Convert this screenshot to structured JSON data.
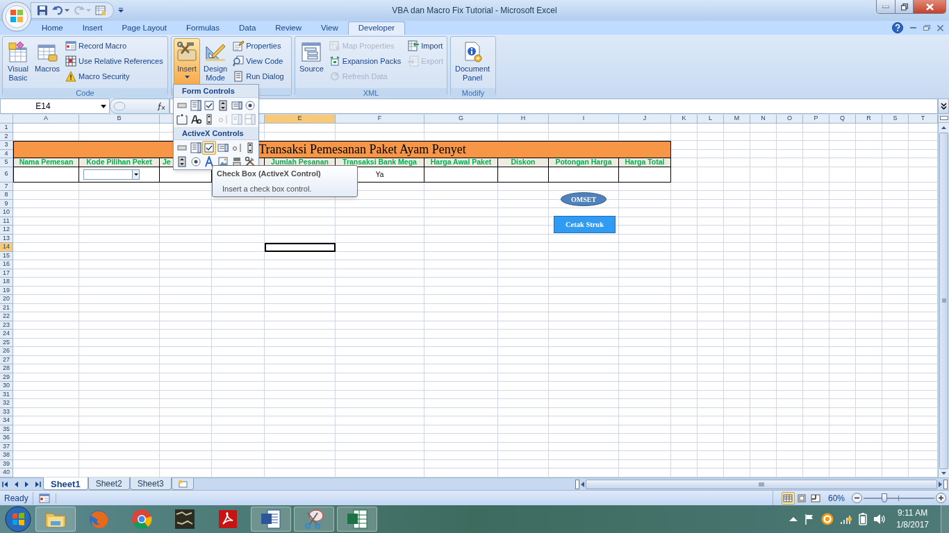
{
  "window": {
    "title": "VBA dan Macro Fix Tutorial - Microsoft Excel"
  },
  "tabs": [
    {
      "label": "Home",
      "selected": false
    },
    {
      "label": "Insert",
      "selected": false
    },
    {
      "label": "Page Layout",
      "selected": false
    },
    {
      "label": "Formulas",
      "selected": false
    },
    {
      "label": "Data",
      "selected": false
    },
    {
      "label": "Review",
      "selected": false
    },
    {
      "label": "View",
      "selected": false
    },
    {
      "label": "Developer",
      "selected": true
    }
  ],
  "ribbon": [
    {
      "label": "Code",
      "items": [
        {
          "label": "Visual Basic",
          "kind": "large",
          "disabled": false,
          "pressed": false
        },
        {
          "label": "Macros",
          "kind": "large",
          "disabled": false,
          "pressed": false
        },
        {
          "label": "Record Macro",
          "kind": "small",
          "disabled": false,
          "pressed": false
        },
        {
          "label": "Use Relative References",
          "kind": "small",
          "disabled": false,
          "pressed": false
        },
        {
          "label": "Macro Security",
          "kind": "small",
          "disabled": false,
          "pressed": false
        }
      ]
    },
    {
      "items": [
        {
          "label": "Insert",
          "kind": "menu",
          "disabled": false,
          "pressed": true
        },
        {
          "label": "Design Mode",
          "kind": "large",
          "disabled": false,
          "pressed": false
        },
        {
          "label": "Properties",
          "kind": "small",
          "disabled": false,
          "pressed": false
        },
        {
          "label": "View Code",
          "kind": "small",
          "disabled": false,
          "pressed": false
        },
        {
          "label": "Run Dialog",
          "kind": "small",
          "disabled": false,
          "pressed": false
        }
      ]
    },
    {
      "label": "XML",
      "items": [
        {
          "label": "Source",
          "kind": "large",
          "disabled": false,
          "pressed": false
        },
        {
          "label": "Map Properties",
          "kind": "small",
          "disabled": true,
          "pressed": false
        },
        {
          "label": "Expansion Packs",
          "kind": "small",
          "disabled": false,
          "pressed": false
        },
        {
          "label": "Refresh Data",
          "kind": "small",
          "disabled": true,
          "pressed": false
        },
        {
          "label": "Import",
          "kind": "small",
          "disabled": false,
          "pressed": false
        },
        {
          "label": "Export",
          "kind": "small",
          "disabled": true,
          "pressed": false
        }
      ]
    },
    {
      "label": "Modify",
      "items": [
        {
          "label": "Document Panel",
          "kind": "large",
          "disabled": false,
          "pressed": false
        }
      ]
    }
  ],
  "formula_bar": {
    "name_box": "E14"
  },
  "sheet": {
    "columns": [
      {
        "label": "A",
        "selected": false
      },
      {
        "label": "B",
        "selected": false
      },
      {
        "selected": false
      },
      {
        "selected": false
      },
      {
        "label": "E",
        "selected": true
      },
      {
        "label": "F",
        "selected": false
      },
      {
        "label": "G",
        "selected": false
      },
      {
        "label": "H",
        "selected": false
      },
      {
        "label": "I",
        "selected": false
      },
      {
        "label": "J",
        "selected": false
      },
      {
        "label": "K",
        "selected": false
      },
      {
        "label": "L",
        "selected": false
      },
      {
        "label": "M",
        "selected": false
      },
      {
        "label": "N",
        "selected": false
      },
      {
        "label": "O",
        "selected": false
      },
      {
        "label": "P",
        "selected": false
      },
      {
        "label": "Q",
        "selected": false
      },
      {
        "label": "R",
        "selected": false
      },
      {
        "label": "S",
        "selected": false
      },
      {
        "label": "T",
        "selected": false
      }
    ],
    "rows": [
      {
        "label": "1",
        "selected": false
      },
      {
        "label": "2",
        "selected": false
      },
      {
        "label": "3",
        "selected": false
      },
      {
        "label": "4",
        "selected": false
      },
      {
        "label": "5",
        "selected": false
      },
      {
        "label": "6",
        "selected": false
      },
      {
        "label": "7",
        "selected": false
      },
      {
        "label": "8",
        "selected": false
      },
      {
        "label": "9",
        "selected": false
      },
      {
        "label": "10",
        "selected": false
      },
      {
        "label": "11",
        "selected": false
      },
      {
        "label": "12",
        "selected": false
      },
      {
        "label": "13",
        "selected": false
      },
      {
        "label": "14",
        "selected": true
      },
      {
        "label": "15",
        "selected": false
      },
      {
        "label": "16",
        "selected": false
      },
      {
        "label": "17",
        "selected": false
      },
      {
        "label": "18",
        "selected": false
      },
      {
        "label": "19",
        "selected": false
      },
      {
        "label": "20",
        "selected": false
      },
      {
        "label": "21",
        "selected": false
      },
      {
        "label": "22",
        "selected": false
      },
      {
        "label": "23",
        "selected": false
      },
      {
        "label": "24",
        "selected": false
      },
      {
        "label": "25",
        "selected": false
      },
      {
        "label": "26",
        "selected": false
      },
      {
        "label": "27",
        "selected": false
      },
      {
        "label": "28",
        "selected": false
      },
      {
        "label": "29",
        "selected": false
      },
      {
        "label": "30",
        "selected": false
      },
      {
        "label": "31",
        "selected": false
      },
      {
        "label": "32",
        "selected": false
      },
      {
        "label": "33",
        "selected": false
      },
      {
        "label": "34",
        "selected": false
      },
      {
        "label": "35",
        "selected": false
      },
      {
        "label": "36",
        "selected": false
      },
      {
        "label": "37",
        "selected": false
      },
      {
        "label": "38",
        "selected": false
      },
      {
        "label": "39",
        "selected": false
      },
      {
        "label": "40",
        "selected": false
      }
    ],
    "title_banner": "Transaksi Pemesanan Paket Ayam Penyet",
    "row_5": [
      {
        "kind": "text",
        "text": "Nama Pemesan"
      },
      {
        "kind": "text",
        "text": "Kode Pilihan Peket"
      },
      {
        "kind": "partial",
        "text": "Je"
      },
      {
        "kind": "blank"
      },
      {
        "kind": "text",
        "text": "Jumlah Pesanan"
      },
      {
        "kind": "text",
        "text": "Transaksi Bank Mega"
      },
      {
        "kind": "text",
        "text": "Harga Awal Paket"
      },
      {
        "kind": "text",
        "text": "Diskon"
      },
      {
        "kind": "text",
        "text": "Potongan Harga"
      },
      {
        "kind": "text",
        "text": "Harga Total"
      }
    ],
    "row_6": [
      {
        "kind": "blank"
      },
      {
        "kind": "combo"
      },
      {
        "kind": "blank"
      },
      {
        "kind": "covered"
      },
      {
        "kind": "covered"
      },
      {
        "kind": "text",
        "text": "Ya"
      },
      {
        "kind": "blank"
      },
      {
        "kind": "blank"
      },
      {
        "kind": "blank"
      },
      {
        "kind": "blank"
      }
    ],
    "shapes": [
      {
        "kind": "oval",
        "text": "OMSET"
      },
      {
        "kind": "button",
        "text": "Cetak Struk"
      }
    ]
  },
  "insert_menu": {
    "sections": [
      {
        "title": "Form Controls",
        "controls": [
          {
            "selected": false,
            "disabled": false
          },
          {
            "selected": false,
            "disabled": false
          },
          {
            "selected": false,
            "disabled": false
          },
          {
            "selected": false,
            "disabled": false
          },
          {
            "selected": false,
            "disabled": false
          },
          {
            "selected": false,
            "disabled": false
          },
          {
            "selected": false,
            "disabled": false
          },
          {
            "selected": false,
            "disabled": false
          },
          {
            "selected": false,
            "disabled": false
          },
          {
            "selected": false,
            "disabled": true
          },
          {
            "selected": false,
            "disabled": true
          },
          {
            "selected": false,
            "disabled": true
          }
        ]
      },
      {
        "title": "ActiveX Controls",
        "controls": [
          {
            "selected": false,
            "disabled": false
          },
          {
            "selected": false,
            "disabled": false
          },
          {
            "selected": true,
            "disabled": false
          },
          {
            "selected": false,
            "disabled": false
          },
          {
            "selected": false,
            "disabled": false
          },
          {
            "selected": false,
            "disabled": false
          },
          {
            "selected": false,
            "disabled": false
          },
          {
            "selected": false,
            "disabled": false
          },
          {
            "selected": false,
            "disabled": false
          },
          {
            "selected": false,
            "disabled": false
          },
          {
            "selected": false,
            "disabled": false
          },
          {
            "selected": false,
            "disabled": false
          }
        ]
      }
    ]
  },
  "tooltip": {
    "title": "Check Box (ActiveX Control)",
    "description": "Insert a check box control."
  },
  "sheet_tabs": [
    {
      "label": "Sheet1",
      "selected": true
    },
    {
      "label": "Sheet2",
      "selected": false
    },
    {
      "label": "Sheet3",
      "selected": false
    }
  ],
  "status_bar": {
    "status": "Ready",
    "views": [
      {
        "selected": true
      },
      {
        "selected": false
      },
      {
        "selected": false
      }
    ],
    "zoom": "60%",
    "zoom_slider": {
      "level": 0.29
    }
  },
  "taskbar": {
    "apps": [
      {
        "running": true
      },
      {
        "running": false
      },
      {
        "running": false
      },
      {
        "running": false
      },
      {
        "running": false
      },
      {
        "running": true
      },
      {
        "running": true
      },
      {
        "running": true
      }
    ],
    "clock": {
      "time": "9:11 AM",
      "date": "1/8/2017"
    }
  }
}
